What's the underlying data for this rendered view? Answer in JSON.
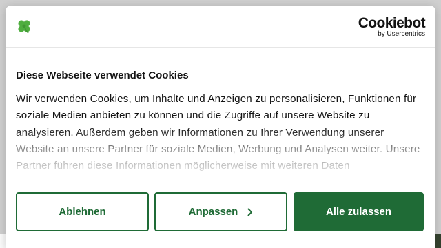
{
  "header": {
    "logo_icon": "clover-icon",
    "brand_name": "Cookiebot",
    "brand_sub": "by Usercentrics"
  },
  "content": {
    "title": "Diese Webseite verwendet Cookies",
    "body": "Wir verwenden Cookies, um Inhalte und Anzeigen zu personalisieren, Funktionen für soziale Medien anbieten zu können und die Zugriffe auf unsere Website zu analysieren. Außerdem geben wir Informationen zu Ihrer Verwendung unserer Website an unsere Partner für soziale Medien, Werbung und Analysen weiter. Unsere Partner führen diese Informationen möglicherweise mit weiteren Daten"
  },
  "buttons": {
    "decline_label": "Ablehnen",
    "customize_label": "Anpassen",
    "customize_icon": "chevron-right-icon",
    "accept_label": "Alle zulassen"
  },
  "colors": {
    "accent": "#1f6b36",
    "clover": "#4fae3f",
    "text": "#141414"
  }
}
